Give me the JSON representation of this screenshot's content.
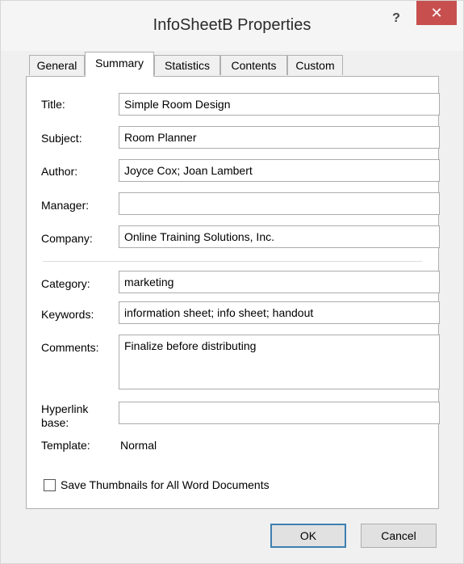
{
  "window": {
    "title": "InfoSheetB Properties",
    "help_glyph": "?",
    "close_glyph": "✕"
  },
  "tabs": [
    {
      "label": "General"
    },
    {
      "label": "Summary"
    },
    {
      "label": "Statistics"
    },
    {
      "label": "Contents"
    },
    {
      "label": "Custom"
    }
  ],
  "active_tab": "Summary",
  "fields": {
    "title": {
      "label": "Title:",
      "value": "Simple Room Design"
    },
    "subject": {
      "label": "Subject:",
      "value": "Room Planner"
    },
    "author": {
      "label": "Author:",
      "value": "Joyce Cox; Joan Lambert"
    },
    "manager": {
      "label": "Manager:",
      "value": ""
    },
    "company": {
      "label": "Company:",
      "value": "Online Training Solutions, Inc."
    },
    "category": {
      "label": "Category:",
      "value": "marketing"
    },
    "keywords": {
      "label": "Keywords:",
      "value": "information sheet; info sheet; handout"
    },
    "comments": {
      "label": "Comments:",
      "value": "Finalize before distributing"
    },
    "hyperlink_base": {
      "label_line1": "Hyperlink",
      "label_line2": "base:",
      "value": ""
    },
    "template": {
      "label": "Template:",
      "value": "Normal"
    }
  },
  "checkbox": {
    "label": "Save Thumbnails for All Word Documents",
    "checked": false
  },
  "buttons": {
    "ok": "OK",
    "cancel": "Cancel"
  },
  "colors": {
    "close_button": "#c7504f",
    "default_button_border": "#3c7fb1"
  }
}
